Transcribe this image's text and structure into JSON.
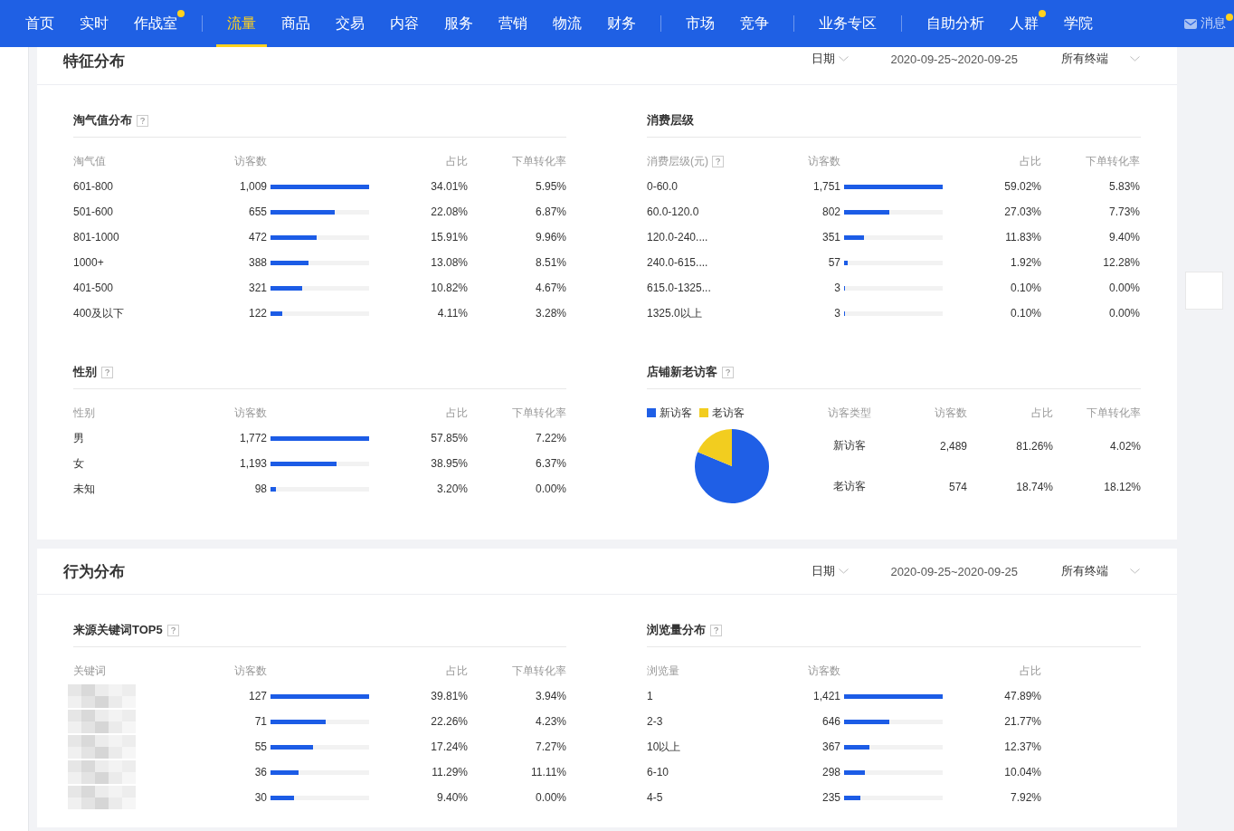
{
  "nav": {
    "groups": [
      [
        {
          "label": "首页",
          "selected": false,
          "dot": false
        },
        {
          "label": "实时",
          "selected": false,
          "dot": false
        },
        {
          "label": "作战室",
          "selected": false,
          "dot": true
        }
      ],
      [
        {
          "label": "流量",
          "selected": true,
          "dot": false
        },
        {
          "label": "商品",
          "selected": false,
          "dot": false
        },
        {
          "label": "交易",
          "selected": false,
          "dot": false
        },
        {
          "label": "内容",
          "selected": false,
          "dot": false
        },
        {
          "label": "服务",
          "selected": false,
          "dot": false
        },
        {
          "label": "营销",
          "selected": false,
          "dot": false
        },
        {
          "label": "物流",
          "selected": false,
          "dot": false
        },
        {
          "label": "财务",
          "selected": false,
          "dot": false
        }
      ],
      [
        {
          "label": "市场",
          "selected": false,
          "dot": false
        },
        {
          "label": "竞争",
          "selected": false,
          "dot": false
        }
      ],
      [
        {
          "label": "业务专区",
          "selected": false,
          "dot": false
        }
      ],
      [
        {
          "label": "自助分析",
          "selected": false,
          "dot": false
        },
        {
          "label": "人群",
          "selected": false,
          "dot": true
        },
        {
          "label": "学院",
          "selected": false,
          "dot": false
        }
      ]
    ],
    "messages": {
      "label": "消息",
      "dot": true
    }
  },
  "sections": [
    {
      "title": "特征分布",
      "filters": {
        "date_label": "日期",
        "date_range": "2020-09-25~2020-09-25",
        "terminal": "所有终端"
      },
      "panels": [
        {
          "kind": "table",
          "title": "淘气值分布",
          "help": true,
          "first_column_help": false,
          "columns": [
            "淘气值",
            "访客数",
            "占比",
            "下单转化率"
          ],
          "rows": [
            {
              "label": "601-800",
              "visitors": "1,009",
              "level": 1,
              "share": "34.01%",
              "rate": "5.95%"
            },
            {
              "label": "501-600",
              "visitors": "655",
              "level": 0.649,
              "share": "22.08%",
              "rate": "6.87%"
            },
            {
              "label": "801-1000",
              "visitors": "472",
              "level": 0.468,
              "share": "15.91%",
              "rate": "9.96%"
            },
            {
              "label": "1000+",
              "visitors": "388",
              "level": 0.385,
              "share": "13.08%",
              "rate": "8.51%"
            },
            {
              "label": "401-500",
              "visitors": "321",
              "level": 0.318,
              "share": "10.82%",
              "rate": "4.67%"
            },
            {
              "label": "400及以下",
              "visitors": "122",
              "level": 0.121,
              "share": "4.11%",
              "rate": "3.28%"
            }
          ]
        },
        {
          "kind": "table",
          "title": "消费层级",
          "help": false,
          "first_column_help": true,
          "columns": [
            "消费层级(元)",
            "访客数",
            "占比",
            "下单转化率"
          ],
          "rows": [
            {
              "label": "0-60.0",
              "visitors": "1,751",
              "level": 1,
              "share": "59.02%",
              "rate": "5.83%"
            },
            {
              "label": "60.0-120.0",
              "visitors": "802",
              "level": 0.458,
              "share": "27.03%",
              "rate": "7.73%"
            },
            {
              "label": "120.0-240....",
              "visitors": "351",
              "level": 0.2,
              "share": "11.83%",
              "rate": "9.40%"
            },
            {
              "label": "240.0-615....",
              "visitors": "57",
              "level": 0.033,
              "share": "1.92%",
              "rate": "12.28%"
            },
            {
              "label": "615.0-1325...",
              "visitors": "3",
              "level": 0.002,
              "share": "0.10%",
              "rate": "0.00%"
            },
            {
              "label": "1325.0以上",
              "visitors": "3",
              "level": 0.002,
              "share": "0.10%",
              "rate": "0.00%"
            }
          ]
        },
        {
          "kind": "table",
          "title": "性别",
          "help": true,
          "first_column_help": false,
          "columns": [
            "性别",
            "访客数",
            "占比",
            "下单转化率"
          ],
          "rows": [
            {
              "label": "男",
              "visitors": "1,772",
              "level": 1,
              "share": "57.85%",
              "rate": "7.22%"
            },
            {
              "label": "女",
              "visitors": "1,193",
              "level": 0.673,
              "share": "38.95%",
              "rate": "6.37%"
            },
            {
              "label": "未知",
              "visitors": "98",
              "level": 0.055,
              "share": "3.20%",
              "rate": "0.00%"
            }
          ]
        },
        {
          "kind": "pie",
          "title": "店铺新老访客",
          "help": true,
          "chart_data": {
            "type": "pie",
            "categories": [
              "新访客",
              "老访客"
            ],
            "series": [
              {
                "values": [
                  81.26,
                  18.74
                ]
              }
            ]
          },
          "columns": [
            "访客类型",
            "访客数",
            "占比",
            "下单转化率"
          ],
          "rows": [
            {
              "label": "新访客",
              "visitors": "2,489",
              "share": "81.26%",
              "rate": "4.02%"
            },
            {
              "label": "老访客",
              "visitors": "574",
              "share": "18.74%",
              "rate": "18.12%"
            }
          ]
        }
      ]
    },
    {
      "title": "行为分布",
      "filters": {
        "date_label": "日期",
        "date_range": "2020-09-25~2020-09-25",
        "terminal": "所有终端"
      },
      "panels": [
        {
          "kind": "table",
          "title": "来源关键词TOP5",
          "help": true,
          "first_column_help": false,
          "columns": [
            "关键词",
            "访客数",
            "占比",
            "下单转化率"
          ],
          "rows": [
            {
              "visitors": "127",
              "level": 1,
              "share": "39.81%",
              "rate": "3.94%"
            },
            {
              "visitors": "71",
              "level": 0.559,
              "share": "22.26%",
              "rate": "4.23%"
            },
            {
              "visitors": "55",
              "level": 0.433,
              "share": "17.24%",
              "rate": "7.27%"
            },
            {
              "visitors": "36",
              "level": 0.283,
              "share": "11.29%",
              "rate": "11.11%"
            },
            {
              "visitors": "30",
              "level": 0.236,
              "share": "9.40%",
              "rate": "0.00%"
            }
          ]
        },
        {
          "kind": "table",
          "title": "浏览量分布",
          "help": true,
          "first_column_help": false,
          "columns": [
            "浏览量",
            "访客数",
            "占比"
          ],
          "rows": [
            {
              "label": "1",
              "visitors": "1,421",
              "level": 1,
              "share": "47.89%"
            },
            {
              "label": "2-3",
              "visitors": "646",
              "level": 0.455,
              "share": "21.77%"
            },
            {
              "label": "10以上",
              "visitors": "367",
              "level": 0.258,
              "share": "12.37%"
            },
            {
              "label": "6-10",
              "visitors": "298",
              "level": 0.21,
              "share": "10.04%"
            },
            {
              "label": "4-5",
              "visitors": "235",
              "level": 0.165,
              "share": "7.92%"
            }
          ]
        }
      ]
    }
  ]
}
